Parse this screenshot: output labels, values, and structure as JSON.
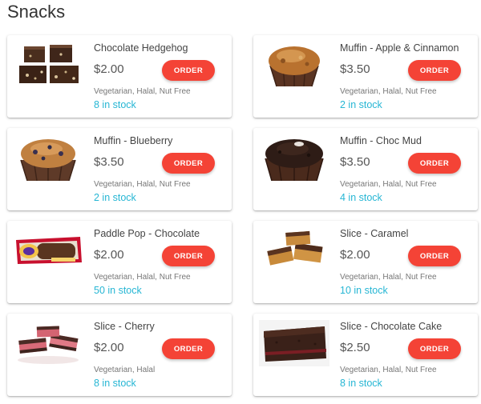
{
  "section": {
    "title": "Snacks"
  },
  "colors": {
    "order_button": "#f44336",
    "stock_text": "#26b6d4"
  },
  "products": [
    {
      "name": "Chocolate Hedgehog",
      "price": "$2.00",
      "order_label": "ORDER",
      "tags": "Vegetarian, Halal, Nut Free",
      "stock": "8 in stock",
      "image": "chocolate-hedgehog-image"
    },
    {
      "name": "Muffin - Apple & Cinnamon",
      "price": "$3.50",
      "order_label": "ORDER",
      "tags": "Vegetarian, Halal, Nut Free",
      "stock": "2 in stock",
      "image": "apple-cinnamon-muffin-image"
    },
    {
      "name": "Muffin - Blueberry",
      "price": "$3.50",
      "order_label": "ORDER",
      "tags": "Vegetarian, Halal, Nut Free",
      "stock": "2 in stock",
      "image": "blueberry-muffin-image"
    },
    {
      "name": "Muffin - Choc Mud",
      "price": "$3.50",
      "order_label": "ORDER",
      "tags": "Vegetarian, Halal, Nut Free",
      "stock": "4 in stock",
      "image": "choc-mud-muffin-image"
    },
    {
      "name": "Paddle Pop - Chocolate",
      "price": "$2.00",
      "order_label": "ORDER",
      "tags": "Vegetarian, Halal, Nut Free",
      "stock": "50 in stock",
      "image": "paddle-pop-image"
    },
    {
      "name": "Slice - Caramel",
      "price": "$2.00",
      "order_label": "ORDER",
      "tags": "Vegetarian, Halal, Nut Free",
      "stock": "10 in stock",
      "image": "caramel-slice-image"
    },
    {
      "name": "Slice - Cherry",
      "price": "$2.00",
      "order_label": "ORDER",
      "tags": "Vegetarian, Halal",
      "stock": "8 in stock",
      "image": "cherry-slice-image"
    },
    {
      "name": "Slice - Chocolate Cake",
      "price": "$2.50",
      "order_label": "ORDER",
      "tags": "Vegetarian, Halal, Nut Free",
      "stock": "8 in stock",
      "image": "chocolate-cake-image"
    }
  ]
}
